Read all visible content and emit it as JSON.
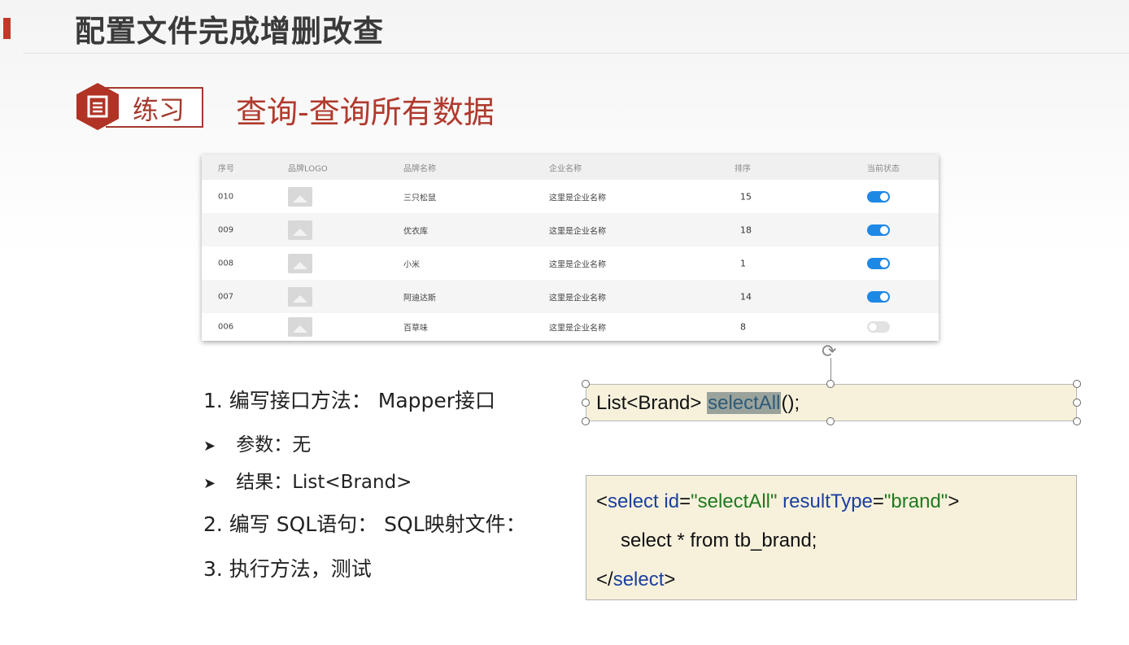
{
  "header": {
    "title": "配置文件完成增删改查"
  },
  "badge": {
    "label": "练习",
    "icon": "document-icon"
  },
  "section": {
    "title": "查询-查询所有数据"
  },
  "table": {
    "columns": [
      "序号",
      "品牌LOGO",
      "品牌名称",
      "企业名称",
      "排序",
      "当前状态"
    ],
    "rows": [
      {
        "id": "010",
        "brand": "三只松鼠",
        "company": "这里是企业名称",
        "sort": "15",
        "enabled": true
      },
      {
        "id": "009",
        "brand": "优衣库",
        "company": "这里是企业名称",
        "sort": "18",
        "enabled": true
      },
      {
        "id": "008",
        "brand": "小米",
        "company": "这里是企业名称",
        "sort": "1",
        "enabled": true
      },
      {
        "id": "007",
        "brand": "阿迪达斯",
        "company": "这里是企业名称",
        "sort": "14",
        "enabled": true
      },
      {
        "id": "006",
        "brand": "百草味",
        "company": "这里是企业名称",
        "sort": "8",
        "enabled": false
      }
    ],
    "toggle_on_color": "#1e88e5",
    "toggle_off_color": "#e2e2e2"
  },
  "steps": {
    "s1": "1.   编写接口方法：  Mapper接口",
    "p1": "参数：无",
    "p2": "结果：List<Brand>",
    "s2": "2.   编写 SQL语句：  SQL映射文件：",
    "s3": "3.   执行方法，测试",
    "bullet": "➤"
  },
  "code1": {
    "pre": "List<Brand> ",
    "method": "selectAll",
    "post": "();"
  },
  "code2": {
    "l1_open": "<",
    "l1_tag": "select",
    "l1_attr1": " id",
    "l1_eq1": "=",
    "l1_val1": "\"selectAll\"",
    "l1_attr2": " resultType",
    "l1_eq2": "=",
    "l1_val2": "\"brand\"",
    "l1_close": ">",
    "l2": "select * from tb_brand;",
    "l3_open": "</",
    "l3_tag": "select",
    "l3_close": ">"
  },
  "colors": {
    "accent": "#c0392b",
    "section_title": "#b03a2e",
    "code_bg": "#f7f1dc",
    "keyword": "#1a3fa0",
    "string": "#1f7a1f"
  }
}
